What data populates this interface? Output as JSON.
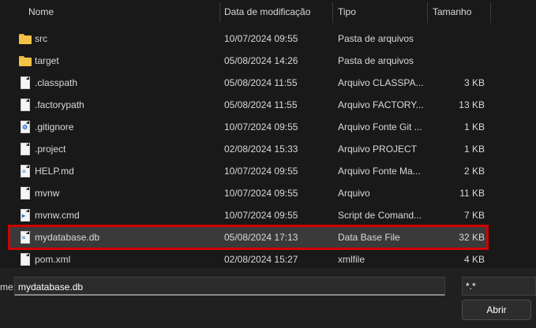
{
  "columns": {
    "name": "Nome",
    "date": "Data de modificação",
    "type": "Tipo",
    "size": "Tamanho"
  },
  "files": [
    {
      "name": "src",
      "date": "10/07/2024 09:55",
      "type": "Pasta de arquivos",
      "size": "",
      "icon": "folder-icon"
    },
    {
      "name": "target",
      "date": "05/08/2024 14:26",
      "type": "Pasta de arquivos",
      "size": "",
      "icon": "folder-icon"
    },
    {
      "name": ".classpath",
      "date": "05/08/2024 11:55",
      "type": "Arquivo CLASSPA...",
      "size": "3 KB",
      "icon": "file-icon"
    },
    {
      "name": ".factorypath",
      "date": "05/08/2024 11:55",
      "type": "Arquivo FACTORY...",
      "size": "13 KB",
      "icon": "file-icon"
    },
    {
      "name": ".gitignore",
      "date": "10/07/2024 09:55",
      "type": "Arquivo Fonte Git ...",
      "size": "1 KB",
      "icon": "settings-file-icon"
    },
    {
      "name": ".project",
      "date": "02/08/2024 15:33",
      "type": "Arquivo PROJECT",
      "size": "1 KB",
      "icon": "file-icon"
    },
    {
      "name": "HELP.md",
      "date": "10/07/2024 09:55",
      "type": "Arquivo Fonte Ma...",
      "size": "2 KB",
      "icon": "markdown-file-icon"
    },
    {
      "name": "mvnw",
      "date": "10/07/2024 09:55",
      "type": "Arquivo",
      "size": "11 KB",
      "icon": "file-icon"
    },
    {
      "name": "mvnw.cmd",
      "date": "10/07/2024 09:55",
      "type": "Script de Comand...",
      "size": "7 KB",
      "icon": "script-file-icon"
    },
    {
      "name": "mydatabase.db",
      "date": "05/08/2024 17:13",
      "type": "Data Base File",
      "size": "32 KB",
      "icon": "database-file-icon"
    },
    {
      "name": "pom.xml",
      "date": "02/08/2024 15:27",
      "type": "xmlfile",
      "size": "4 KB",
      "icon": "file-icon"
    }
  ],
  "bottom": {
    "filename_label": "me:",
    "filename_value": "mydatabase.db",
    "filter_value": "*.*",
    "open_label": "Abrir"
  },
  "colors": {
    "background": "#191919",
    "selection": "#3a3a3a",
    "highlight_border": "#d00000",
    "folder": "#f3c147"
  }
}
